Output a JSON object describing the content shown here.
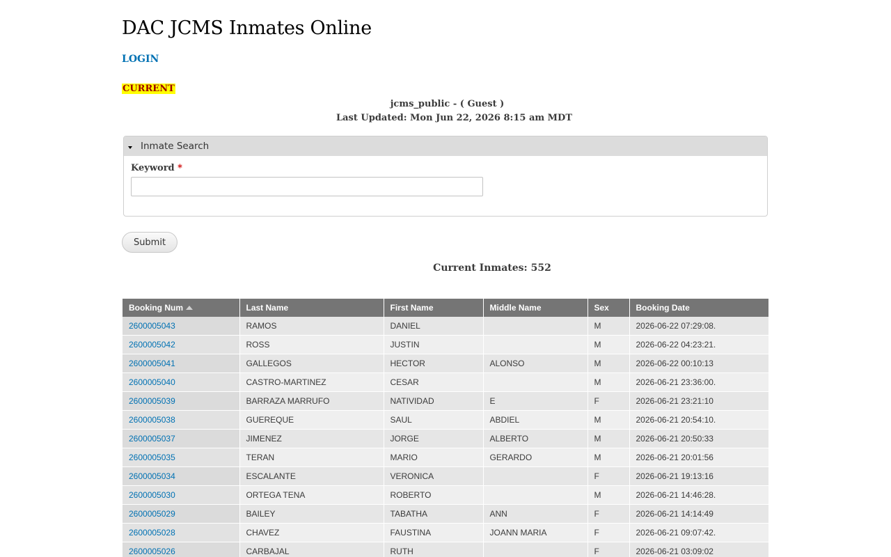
{
  "site": {
    "title": "DAC JCMS Inmates Online",
    "login_label": "LOGIN",
    "current_label": "CURRENT",
    "user_line": "jcms_public - ( Guest )",
    "last_updated": "Last Updated: Mon Jun 22, 2026 8:15 am MDT"
  },
  "search": {
    "legend": "Inmate Search",
    "keyword_label": "Keyword",
    "required_mark": "*",
    "keyword_value": "",
    "submit_label": "Submit"
  },
  "summary": {
    "count_text": "Current Inmates: 552"
  },
  "table": {
    "columns": [
      "Booking Num",
      "Last Name",
      "First Name",
      "Middle Name",
      "Sex",
      "Booking Date"
    ],
    "sorted_column": "Booking Num",
    "rows": [
      [
        "2600005043",
        "RAMOS",
        "DANIEL",
        "",
        "M",
        "2026-06-22 07:29:08."
      ],
      [
        "2600005042",
        "ROSS",
        "JUSTIN",
        "",
        "M",
        "2026-06-22 04:23:21."
      ],
      [
        "2600005041",
        "GALLEGOS",
        "HECTOR",
        "ALONSO",
        "M",
        "2026-06-22 00:10:13"
      ],
      [
        "2600005040",
        "CASTRO-MARTINEZ",
        "CESAR",
        "",
        "M",
        "2026-06-21 23:36:00."
      ],
      [
        "2600005039",
        "BARRAZA MARRUFO",
        "NATIVIDAD",
        "E",
        "F",
        "2026-06-21 23:21:10"
      ],
      [
        "2600005038",
        "GUEREQUE",
        "SAUL",
        "ABDIEL",
        "M",
        "2026-06-21 20:54:10."
      ],
      [
        "2600005037",
        "JIMENEZ",
        "JORGE",
        "ALBERTO",
        "M",
        "2026-06-21 20:50:33"
      ],
      [
        "2600005035",
        "TERAN",
        "MARIO",
        "GERARDO",
        "M",
        "2026-06-21 20:01:56"
      ],
      [
        "2600005034",
        "ESCALANTE",
        "VERONICA",
        "",
        "F",
        "2026-06-21 19:13:16"
      ],
      [
        "2600005030",
        "ORTEGA TENA",
        "ROBERTO",
        "",
        "M",
        "2026-06-21 14:46:28."
      ],
      [
        "2600005029",
        "BAILEY",
        "TABATHA",
        "ANN",
        "F",
        "2026-06-21 14:14:49"
      ],
      [
        "2600005028",
        "CHAVEZ",
        "FAUSTINA",
        "JOANN MARIA",
        "F",
        "2026-06-21 09:07:42."
      ],
      [
        "2600005026",
        "CARBAJAL",
        "RUTH",
        "",
        "F",
        "2026-06-21 03:09:02"
      ]
    ]
  },
  "colors": {
    "link": "#0071b3",
    "header_bg": "#757575",
    "highlight": "#ffff00",
    "current_text": "#9e0000"
  }
}
